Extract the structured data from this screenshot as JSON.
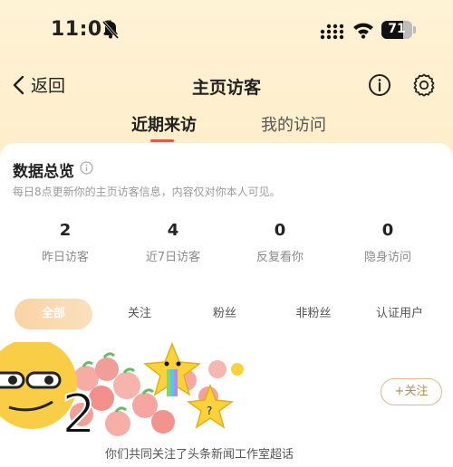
{
  "status_bar": {
    "time": "11:01",
    "battery_level": "71",
    "battery_fraction": 0.71,
    "icons": [
      "mute-icon",
      "signal-icon",
      "wifi-icon",
      "battery-icon"
    ]
  },
  "nav": {
    "back_label": "返回",
    "title": "主页访客",
    "icons": [
      "back-icon",
      "info-icon",
      "gear-icon"
    ]
  },
  "tabs": [
    {
      "label": "近期来访",
      "active": true
    },
    {
      "label": "我的访问",
      "active": false
    }
  ],
  "overview": {
    "title": "数据总览",
    "description": "每日8点更新你的主页访客信息，内容仅对你本人可见。",
    "stats": [
      {
        "value": "2",
        "label": "昨日访客"
      },
      {
        "value": "4",
        "label": "近7日访客"
      },
      {
        "value": "0",
        "label": "反复看你"
      },
      {
        "value": "0",
        "label": "隐身访问"
      }
    ]
  },
  "filters": [
    {
      "label": "全部",
      "active": true
    },
    {
      "label": "关注",
      "active": false
    },
    {
      "label": "粉丝",
      "active": false
    },
    {
      "label": "非粉丝",
      "active": false
    },
    {
      "label": "认证用户",
      "active": false
    }
  ],
  "visitor": {
    "follow_label": "+关注",
    "note": "你们共同关注了头条新闻工作室超话"
  },
  "colors": {
    "accent": "#e45a3c",
    "chip_active": "#f9d3a4",
    "follow_border": "#d9b98d"
  }
}
